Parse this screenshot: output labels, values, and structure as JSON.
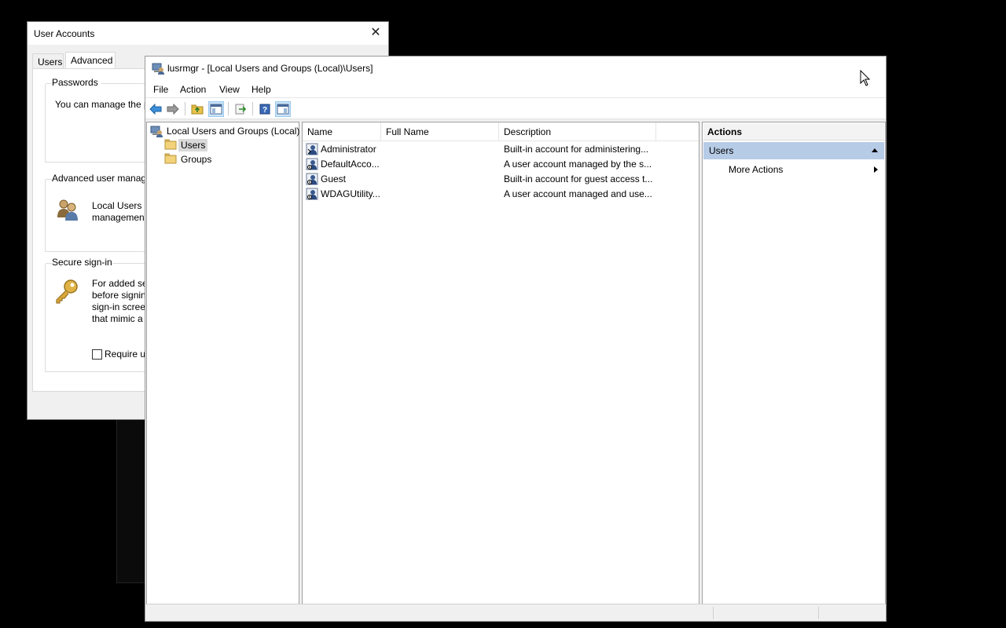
{
  "user_accounts": {
    "title": "User Accounts",
    "close_glyph": "✕",
    "tabs": [
      "Users",
      "Advanced"
    ],
    "active_tab": "Advanced",
    "passwords": {
      "heading": "Passwords",
      "text": "You can manage the p"
    },
    "advanced_user": {
      "heading": "Advanced user manag",
      "text_line1": "Local Users a",
      "text_line2": "managemen"
    },
    "secure_signin": {
      "heading": "Secure sign-in",
      "lines": [
        "For added se",
        "before signin",
        "sign-in scree",
        "that mimic a"
      ],
      "checkbox_label": "Require us"
    }
  },
  "mmc": {
    "title": "lusrmgr - [Local Users and Groups (Local)\\Users]",
    "menu": [
      "File",
      "Action",
      "View",
      "Help"
    ],
    "toolbar": [
      "back-icon",
      "forward-icon",
      "up-folder-icon",
      "show-hide-tree-icon",
      "export-list-icon",
      "help-icon",
      "show-hide-action-pane-icon"
    ],
    "tree": {
      "root": "Local Users and Groups (Local)",
      "children": [
        "Users",
        "Groups"
      ],
      "selected": "Users"
    },
    "list": {
      "columns": [
        "Name",
        "Full Name",
        "Description"
      ],
      "rows": [
        {
          "name": "Administrator",
          "full_name": "",
          "description": "Built-in account for administering..."
        },
        {
          "name": "DefaultAcco...",
          "full_name": "",
          "description": "A user account managed by the s..."
        },
        {
          "name": "Guest",
          "full_name": "",
          "description": "Built-in account for guest access t..."
        },
        {
          "name": "WDAGUtility...",
          "full_name": "",
          "description": "A user account managed and use..."
        }
      ]
    },
    "actions": {
      "header": "Actions",
      "section": "Users",
      "more": "More Actions"
    }
  },
  "colors": {
    "selection_blue": "#b6cbe6",
    "tree_selected": "#d9d9d9",
    "folder": "#f2c75c"
  }
}
